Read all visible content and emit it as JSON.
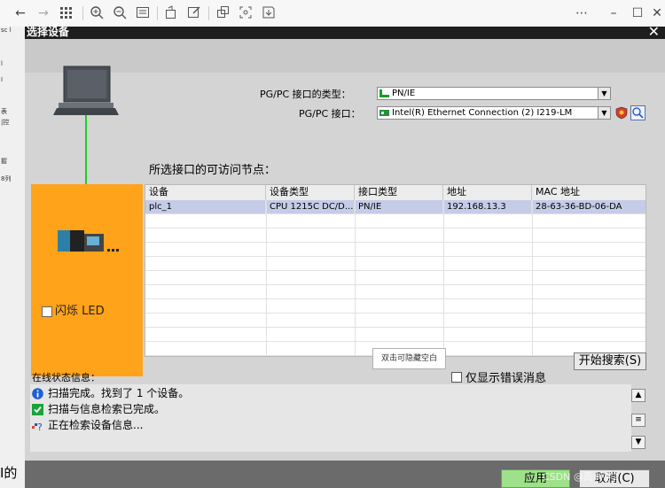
{
  "dialog": {
    "title": "选择设备",
    "close_glyph": "✕",
    "pgpc_type_label": "PG/PC 接口的类型：",
    "pgpc_type_value": "PN/IE",
    "pgpc_label": "PG/PC 接口：",
    "pgpc_value": "Intel(R) Ethernet Connection (2) I219-LM",
    "nodes_heading": "所选接口的可访问节点：",
    "flash_led_label": "闪烁 LED",
    "tooltip": "双击可隐藏空白",
    "start_search_label": "开始搜索(S)",
    "only_errors_label": "仅显示错误消息",
    "status_heading": "在线状态信息：",
    "apply_label": "应用",
    "cancel_label": "取消(C)"
  },
  "table": {
    "columns": [
      "设备",
      "设备类型",
      "接口类型",
      "地址",
      "MAC 地址"
    ],
    "rows": [
      [
        "plc_1",
        "CPU 1215C DC/D...",
        "PN/IE",
        "192.168.13.3",
        "28-63-36-BD-06-DA"
      ]
    ]
  },
  "status": [
    {
      "icon": "info-icon",
      "text": "扫描完成。找到了 1 个设备。"
    },
    {
      "icon": "check-icon",
      "text": "扫描与信息检索已完成。"
    },
    {
      "icon": "searching-icon",
      "text": "正在检索设备信息..."
    }
  ],
  "left_fragment": {
    "lines": [
      "sc l",
      "l",
      "I",
      "表",
      "|控",
      "握",
      "8列"
    ],
    "bottom": "I的"
  },
  "watermark": "CSDN @周利宇2",
  "colors": {
    "orange_panel": "#ffa31a",
    "selected_row": "#c5cce8",
    "green_link": "#22cc22",
    "dialog_bg": "#d4d4d4"
  }
}
